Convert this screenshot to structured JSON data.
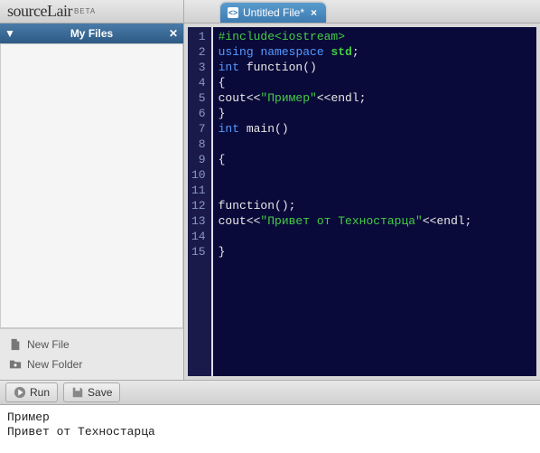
{
  "logo": {
    "brand": "source",
    "suffix": "Lair",
    "beta": "BETA"
  },
  "sidebar": {
    "title": "My Files",
    "actions": {
      "new_file": "New File",
      "new_folder": "New Folder"
    }
  },
  "tabs": [
    {
      "label": "Untitled File*"
    }
  ],
  "toolbar": {
    "run": "Run",
    "save": "Save"
  },
  "code_lines": [
    [
      {
        "c": "k-pre",
        "t": "#include<iostream>"
      }
    ],
    [
      {
        "c": "k-key",
        "t": "using"
      },
      {
        "c": "",
        "t": " "
      },
      {
        "c": "k-key",
        "t": "namespace"
      },
      {
        "c": "",
        "t": " "
      },
      {
        "c": "k-id",
        "t": "std"
      },
      {
        "c": "",
        "t": ";"
      }
    ],
    [
      {
        "c": "k-type",
        "t": "int"
      },
      {
        "c": "",
        "t": " "
      },
      {
        "c": "k-fn",
        "t": "function()"
      }
    ],
    [
      {
        "c": "",
        "t": "{"
      }
    ],
    [
      {
        "c": "",
        "t": "cout<<"
      },
      {
        "c": "k-str",
        "t": "\"Пример\""
      },
      {
        "c": "",
        "t": "<<endl;"
      }
    ],
    [
      {
        "c": "",
        "t": "}"
      }
    ],
    [
      {
        "c": "k-type",
        "t": "int"
      },
      {
        "c": "",
        "t": " "
      },
      {
        "c": "k-fn",
        "t": "main()"
      }
    ],
    [
      {
        "c": "",
        "t": ""
      }
    ],
    [
      {
        "c": "",
        "t": "{"
      }
    ],
    [
      {
        "c": "",
        "t": ""
      }
    ],
    [
      {
        "c": "",
        "t": ""
      }
    ],
    [
      {
        "c": "",
        "t": "function();"
      }
    ],
    [
      {
        "c": "",
        "t": "cout<<"
      },
      {
        "c": "k-str",
        "t": "\"Привет от Техностарца\""
      },
      {
        "c": "",
        "t": "<<endl;"
      }
    ],
    [
      {
        "c": "",
        "t": ""
      }
    ],
    [
      {
        "c": "",
        "t": "}"
      }
    ]
  ],
  "console_output": "Пример\nПривет от Техностарца"
}
